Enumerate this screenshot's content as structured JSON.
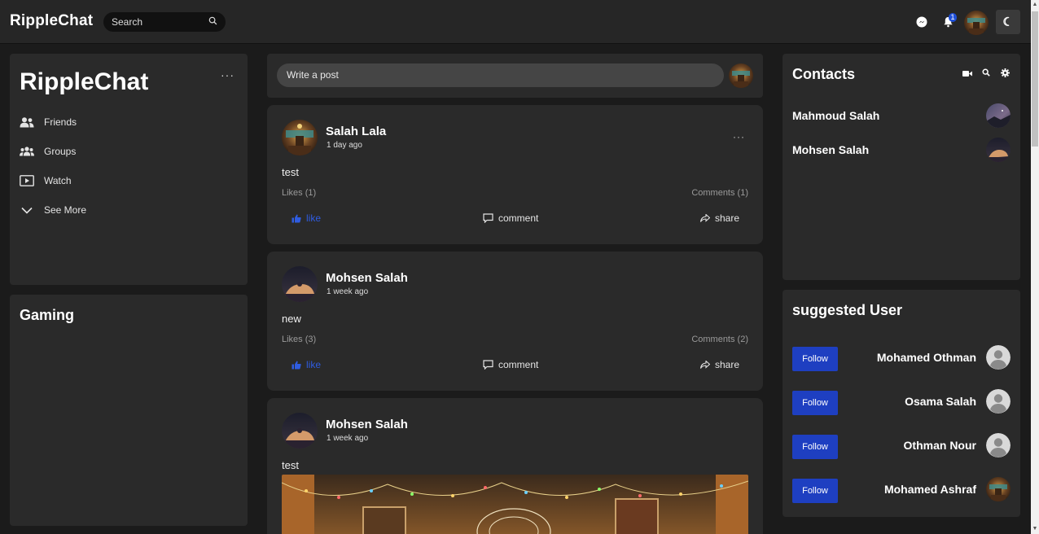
{
  "app": {
    "brand": "RippleChat"
  },
  "topbar": {
    "search_placeholder": "Search",
    "notification_count": "1"
  },
  "left": {
    "title": "RippleChat",
    "nav": [
      {
        "label": "Friends",
        "icon": "friends-icon"
      },
      {
        "label": "Groups",
        "icon": "groups-icon"
      },
      {
        "label": "Watch",
        "icon": "watch-icon"
      },
      {
        "label": "See More",
        "icon": "chevron-down-icon"
      }
    ],
    "gaming_title": "Gaming"
  },
  "composer": {
    "placeholder": "Write a post"
  },
  "posts": [
    {
      "author": "Salah Lala",
      "time": "1 day ago",
      "text": "test",
      "likes": "Likes (1)",
      "comments": "Comments (1)"
    },
    {
      "author": "Mohsen Salah",
      "time": "1 week ago",
      "text": "new",
      "likes": "Likes (3)",
      "comments": "Comments (2)"
    },
    {
      "author": "Mohsen Salah",
      "time": "1 week ago",
      "text": "test"
    }
  ],
  "actions": {
    "like": "like",
    "comment": "comment",
    "share": "share"
  },
  "contacts": {
    "title": "Contacts",
    "items": [
      {
        "name": "Mahmoud Salah"
      },
      {
        "name": "Mohsen Salah"
      }
    ]
  },
  "suggested": {
    "title": "suggested User",
    "follow_label": "Follow",
    "items": [
      {
        "name": "Mohamed Othman"
      },
      {
        "name": "Osama Salah"
      },
      {
        "name": "Othman Nour"
      },
      {
        "name": "Mohamed Ashraf"
      }
    ]
  },
  "colors": {
    "accent": "#1e3fc1",
    "like": "#2f5ce0",
    "panel": "#2a2a2a",
    "background": "#1b1b1b"
  }
}
